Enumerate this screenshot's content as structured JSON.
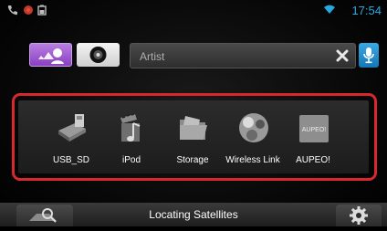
{
  "status": {
    "time": "17:54",
    "icons": [
      "phone-icon",
      "record-icon",
      "battery-icon",
      "wifi-icon"
    ]
  },
  "top": {
    "search_text": "Artist",
    "buttons": [
      "voice-search-button",
      "disc-button",
      "clear-button",
      "microphone-button"
    ]
  },
  "sources": [
    {
      "label": "USB_SD",
      "icon": "usb-sd-icon"
    },
    {
      "label": "iPod",
      "icon": "ipod-icon"
    },
    {
      "label": "Storage",
      "icon": "storage-icon"
    },
    {
      "label": "Wireless Link",
      "icon": "wireless-link-icon"
    },
    {
      "label": "AUPEO!",
      "icon": "aupeo-icon",
      "badge": "AUPEO!"
    }
  ],
  "bottom": {
    "status_text": "Locating Satellites"
  },
  "colors": {
    "accent_time": "#29a8e0",
    "highlight_border": "#d8282f",
    "voice_button": "#9b52cf",
    "mic_button": "#1e8fd0"
  }
}
